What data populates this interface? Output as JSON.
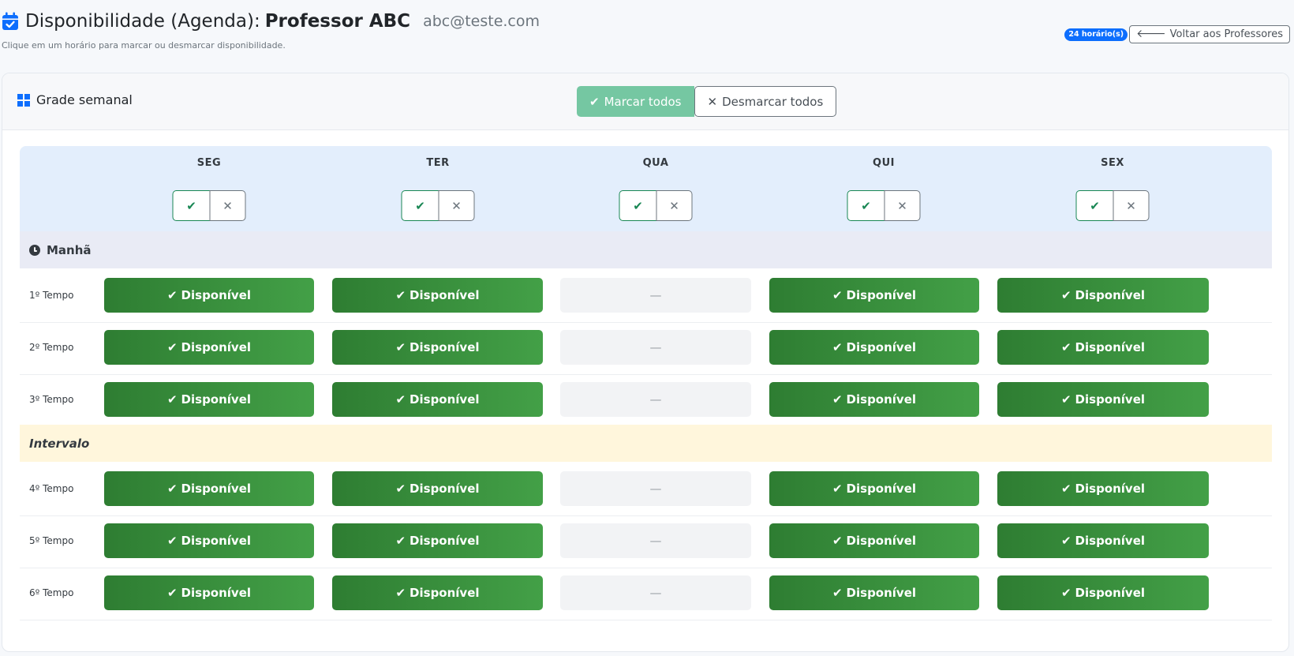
{
  "header": {
    "title": "Disponibilidade (Agenda):",
    "professor": "Professor ABC",
    "email": "abc@teste.com",
    "subtitle": "Clique em um horário para marcar ou desmarcar disponibilidade.",
    "badge": "24 horário(s)",
    "back_label": "Voltar aos Professores"
  },
  "card": {
    "title": "Grade semanal",
    "mark_all": "Marcar todos",
    "unmark_all": "Desmarcar todos"
  },
  "days": [
    "SEG",
    "TER",
    "QUA",
    "QUI",
    "SEX"
  ],
  "sections": {
    "morning": "Manhã",
    "interval": "Intervalo"
  },
  "slots": {
    "available_label": "Disponível",
    "unavailable_label": "—"
  },
  "periods": [
    {
      "label": "1º Tempo",
      "availability": [
        true,
        true,
        false,
        true,
        true
      ]
    },
    {
      "label": "2º Tempo",
      "availability": [
        true,
        true,
        false,
        true,
        true
      ]
    },
    {
      "label": "3º Tempo",
      "availability": [
        true,
        true,
        false,
        true,
        true
      ]
    },
    {
      "label": "4º Tempo",
      "availability": [
        true,
        true,
        false,
        true,
        true
      ]
    },
    {
      "label": "5º Tempo",
      "availability": [
        true,
        true,
        false,
        true,
        true
      ]
    },
    {
      "label": "6º Tempo",
      "availability": [
        true,
        true,
        false,
        true,
        true
      ]
    }
  ],
  "colors": {
    "primary": "#0d6efd",
    "available": "#2e7d32",
    "mark_all_button": "#75c7a2",
    "header_bg": "#e3eefc",
    "interval_bg": "#fff6dc"
  },
  "icons": {
    "calendar": "calendar-check-icon",
    "grid": "windows-grid-icon",
    "check": "check-icon",
    "close": "close-icon",
    "clock": "clock-icon",
    "arrow": "arrow-left-icon"
  }
}
